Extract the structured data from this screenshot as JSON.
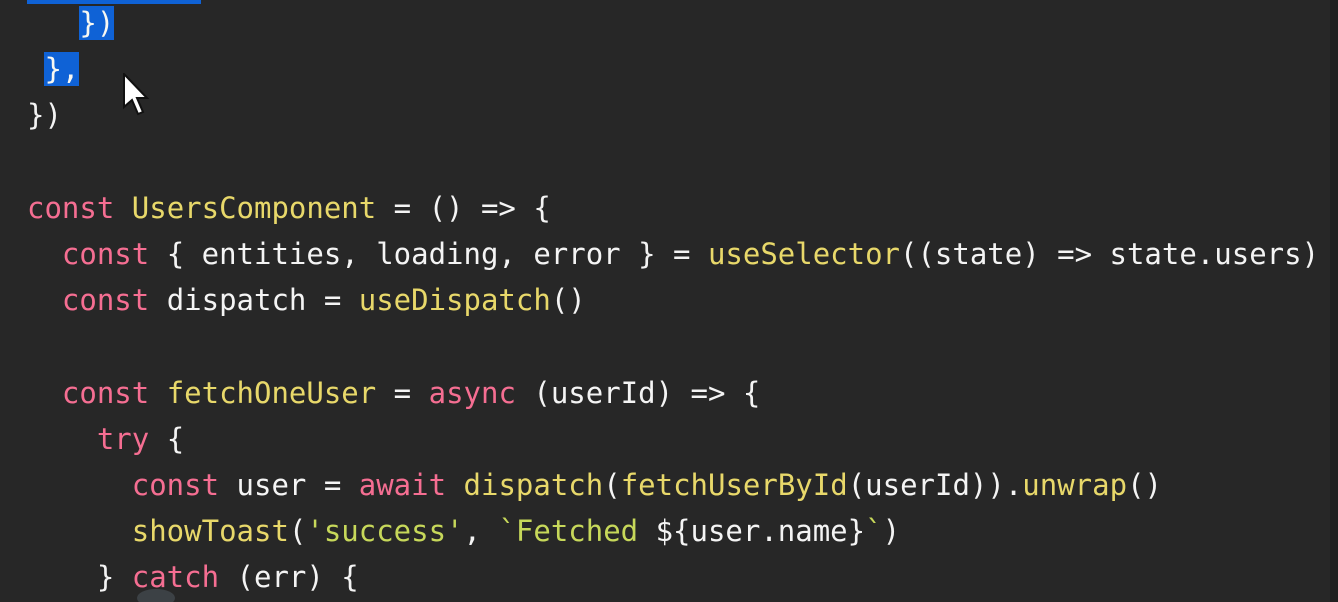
{
  "editor": {
    "background": "#272727",
    "selection_color": "#0f62d6",
    "lines": [
      {
        "indent": "   ",
        "tokens": [
          {
            "type": "sel",
            "text": "})"
          }
        ]
      },
      {
        "indent": " ",
        "tokens": [
          {
            "type": "sel",
            "text": "},"
          }
        ]
      },
      {
        "indent": "",
        "tokens": [
          {
            "type": "pl",
            "text": "})"
          }
        ]
      },
      {
        "indent": "",
        "tokens": []
      },
      {
        "indent": "",
        "tokens": [
          {
            "type": "kw",
            "text": "const"
          },
          {
            "type": "pl",
            "text": " "
          },
          {
            "type": "fn",
            "text": "UsersComponent"
          },
          {
            "type": "pl",
            "text": " = () => {"
          }
        ]
      },
      {
        "indent": "  ",
        "tokens": [
          {
            "type": "kw",
            "text": "const"
          },
          {
            "type": "pl",
            "text": " { entities, loading, error } = "
          },
          {
            "type": "fn",
            "text": "useSelector"
          },
          {
            "type": "pl",
            "text": "((state) => state.users)"
          }
        ]
      },
      {
        "indent": "  ",
        "tokens": [
          {
            "type": "kw",
            "text": "const"
          },
          {
            "type": "pl",
            "text": " dispatch = "
          },
          {
            "type": "fn",
            "text": "useDispatch"
          },
          {
            "type": "pl",
            "text": "()"
          }
        ]
      },
      {
        "indent": "",
        "tokens": []
      },
      {
        "indent": "  ",
        "tokens": [
          {
            "type": "kw",
            "text": "const"
          },
          {
            "type": "pl",
            "text": " "
          },
          {
            "type": "fn",
            "text": "fetchOneUser"
          },
          {
            "type": "pl",
            "text": " = "
          },
          {
            "type": "kw",
            "text": "async"
          },
          {
            "type": "pl",
            "text": " (userId) => {"
          }
        ]
      },
      {
        "indent": "    ",
        "tokens": [
          {
            "type": "kw",
            "text": "try"
          },
          {
            "type": "pl",
            "text": " {"
          }
        ]
      },
      {
        "indent": "      ",
        "tokens": [
          {
            "type": "kw",
            "text": "const"
          },
          {
            "type": "pl",
            "text": " user = "
          },
          {
            "type": "kw",
            "text": "await"
          },
          {
            "type": "pl",
            "text": " "
          },
          {
            "type": "fn",
            "text": "dispatch"
          },
          {
            "type": "pl",
            "text": "("
          },
          {
            "type": "fn",
            "text": "fetchUserById"
          },
          {
            "type": "pl",
            "text": "(userId))."
          },
          {
            "type": "fn",
            "text": "unwrap"
          },
          {
            "type": "pl",
            "text": "()"
          }
        ]
      },
      {
        "indent": "      ",
        "tokens": [
          {
            "type": "fn",
            "text": "showToast"
          },
          {
            "type": "pl",
            "text": "("
          },
          {
            "type": "str",
            "text": "'success'"
          },
          {
            "type": "pl",
            "text": ", "
          },
          {
            "type": "str",
            "text": "`Fetched "
          },
          {
            "type": "pl",
            "text": "${user.name}"
          },
          {
            "type": "str",
            "text": "`"
          },
          {
            "type": "pl",
            "text": ")"
          }
        ]
      },
      {
        "indent": "    ",
        "tokens": [
          {
            "type": "pl",
            "text": "} "
          },
          {
            "type": "kw",
            "text": "catch"
          },
          {
            "type": "pl",
            "text": " (err) {"
          }
        ]
      }
    ]
  }
}
